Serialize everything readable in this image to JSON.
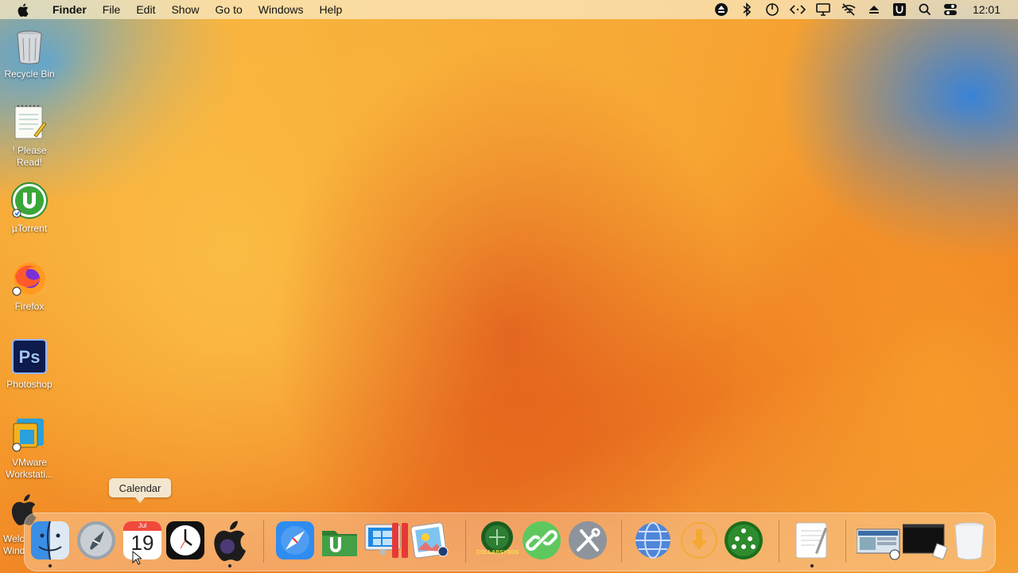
{
  "menubar": {
    "app_name": "Finder",
    "menus": [
      "File",
      "Edit",
      "Show",
      "Go to",
      "Windows",
      "Help"
    ],
    "status_icons": [
      "eject-circle-icon",
      "bluetooth-icon",
      "power-icon",
      "code-icon",
      "display-icon",
      "wifi-off-icon",
      "eject-icon",
      "u-icon",
      "search-icon",
      "control-center-icon"
    ],
    "clock": "12:01"
  },
  "desktop": {
    "icons": [
      {
        "label": "Recycle Bin",
        "icon": "recycle-bin-icon"
      },
      {
        "label": "! Please Read!",
        "icon": "notepad-icon"
      },
      {
        "label": "µTorrent",
        "icon": "utorrent-icon"
      },
      {
        "label": "Firefox",
        "icon": "firefox-icon"
      },
      {
        "label": "Photoshop",
        "icon": "photoshop-icon"
      },
      {
        "label": "VMware Workstati...",
        "icon": "vmware-icon"
      },
      {
        "label": "Welc Wind",
        "icon": "apple-logo-icon"
      }
    ]
  },
  "tooltip": "Calendar",
  "calendar_icon": {
    "month": "Jul",
    "day": "19"
  },
  "dock": {
    "items": [
      "finder-icon",
      "launchpad-icon",
      "calendar-icon",
      "clock-icon",
      "apple-icon",
      "safari-icon",
      "utorrent-folder-icon",
      "windows-display-icon",
      "parallels-icon",
      "photo-viewer-icon",
      "collabsys-icon",
      "link-icon",
      "tools-icon",
      "globe-icon",
      "download-icon",
      "network-icon",
      "textedit-icon",
      "screenshot-thumb-icon",
      "terminal-thumb-icon",
      "trash-icon"
    ],
    "collabsys_text": "COLLABSYSOS"
  }
}
